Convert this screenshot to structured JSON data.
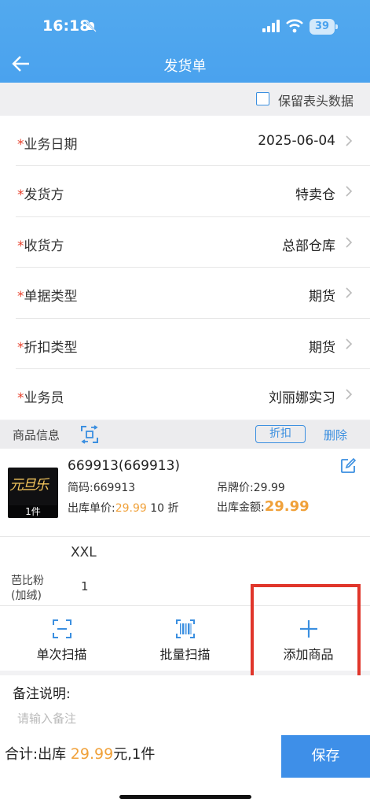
{
  "status": {
    "time": "16:18",
    "battery": "39"
  },
  "nav": {
    "title": "发货单"
  },
  "keep_header": {
    "label": "保留表头数据",
    "checked": false
  },
  "form": {
    "rows": [
      {
        "label": "业务日期",
        "required": "*",
        "value": "2025-06-04"
      },
      {
        "label": "发货方",
        "required": "*",
        "value": "特卖仓"
      },
      {
        "label": "收货方",
        "required": "*",
        "value": "总部仓库"
      },
      {
        "label": "单据类型",
        "required": "*",
        "value": "期货"
      },
      {
        "label": "折扣类型",
        "required": "*",
        "value": "期货"
      },
      {
        "label": "业务员",
        "required": "*",
        "value": "刘丽娜实习"
      }
    ]
  },
  "goods": {
    "header_label": "商品信息",
    "discount_label": "折扣",
    "delete_label": "删除",
    "item": {
      "name": "669913(669913)",
      "thumb_text": "元旦乐",
      "thumb_qty": "1件",
      "code_label": "简码:",
      "code": "669913",
      "tag_label": "吊牌价:",
      "tag_price": "29.99",
      "unit_label": "出库单价:",
      "unit_price": "29.99",
      "discount": "10 折",
      "amount_label": "出库金额:",
      "amount": "29.99"
    },
    "size": "XXL",
    "color_line1": "芭比粉",
    "color_line2": "(加绒)",
    "count": "1"
  },
  "actions": {
    "single_scan": "单次扫描",
    "batch_scan": "批量扫描",
    "add_goods": "添加商品"
  },
  "memo": {
    "label": "备注说明:",
    "placeholder": "请输入备注"
  },
  "footer": {
    "total_prefix": "合计:出库 ",
    "total_amount": "29.99",
    "total_suffix": "元,1件",
    "save_label": "保存"
  },
  "colors": {
    "header": "#4aa2ee",
    "accent": "#3b8fe0",
    "price": "#f0a13a",
    "required": "#e8412c",
    "highlight": "#e0362b"
  }
}
